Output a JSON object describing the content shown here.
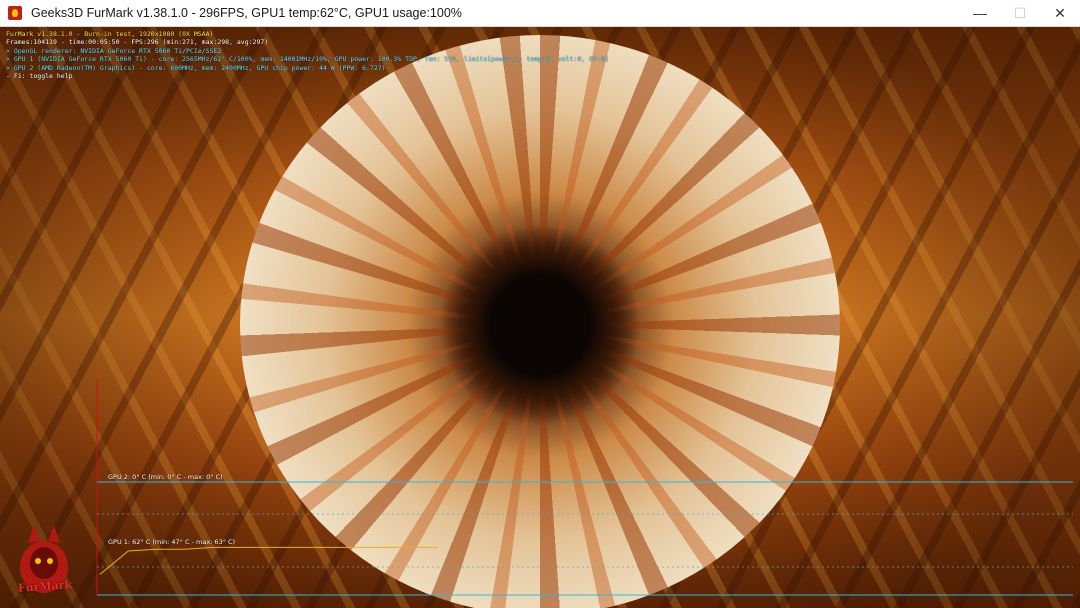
{
  "window": {
    "title": "Geeks3D FurMark v1.38.1.0 - 296FPS, GPU1 temp:62°C, GPU1 usage:100%",
    "minimize": "—",
    "maximize": "☐",
    "close": "✕",
    "icon": "furmark-app-icon"
  },
  "overlay": {
    "line1": "FurMark v1.38.1.0 - Burn-in test, 1920x1080 (0X MSAA)",
    "line2": "Frames:104119 - time:00:05:50 - FPS:296 (min:271, max:298, avg:297)",
    "line3": "> OpenGL renderer: NVIDIA GeForce RTX 5060 Ti/PCIe/SSE2",
    "line4": "> GPU 1 (NVIDIA GeForce RTX 5060 Ti) - core: 2565MHz/62° C/100%, mem: 14001MHz/10%, GPU power: 100.3% TDP, fan: 51%, limits[power:1, temp:0, volt:0, OV:0]",
    "line5": "> GPU 2 (AMD Radeon(TM) Graphics) - core: 600MHz, mem: 2400MHz, GPU chip power: 44 W (PPW: 6.727)",
    "line6": "- F1: toggle help"
  },
  "graphs": {
    "gpu2_label": "GPU 2: 0° C (min: 0° C - max: 0° C)",
    "gpu1_label": "GPU 1: 62° C (min: 47° C - max: 63° C)"
  },
  "logo_text": "FurMark",
  "chart_data": [
    {
      "type": "line",
      "title": "GPU 2: 0° C (min: 0° C - max: 0° C)",
      "series": [
        {
          "name": "GPU 2",
          "values": [
            0,
            0,
            0,
            0,
            0,
            0,
            0,
            0,
            0,
            0
          ]
        }
      ]
    },
    {
      "type": "line",
      "title": "GPU 1: 62° C (min: 47° C - max: 63° C)",
      "series": [
        {
          "name": "GPU 1",
          "values": [
            47,
            60,
            61,
            61,
            62,
            62,
            62,
            62,
            62,
            62,
            62,
            62,
            62
          ]
        }
      ]
    }
  ],
  "colors": {
    "overlay_yellow": "#ffe24a",
    "overlay_cyan": "#5fe0ff",
    "graph_border": "#3ab4d6",
    "graph_line": "#e8b020",
    "graph_axis_red": "#d01010"
  }
}
